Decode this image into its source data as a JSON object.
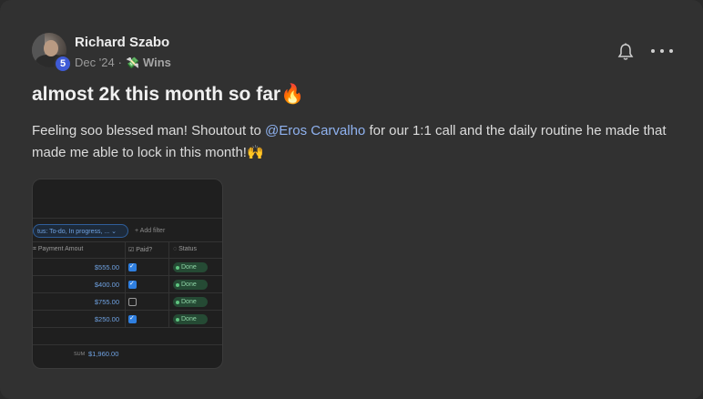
{
  "post": {
    "author": "Richard Szabo",
    "level": "5",
    "date": "Dec '24",
    "separator": "·",
    "category_icon": "money-wings-icon",
    "category": "Wins",
    "title": "almost 2k this month so far🔥",
    "body_before": "Feeling soo blessed man! Shoutout to ",
    "mention": "@Eros Carvalho",
    "body_after": " for our 1:1 call and the daily routine he made that made me able to lock in this month!🙌"
  },
  "attachment": {
    "filter_label": "tus: To-do, In progress, ... ⌄",
    "add_filter": "+ Add filter",
    "columns": {
      "amount": "Payment Amout",
      "paid": "Paid?",
      "status": "Status"
    },
    "rows": [
      {
        "amount": "$555.00",
        "paid": true,
        "status": "Done"
      },
      {
        "amount": "$400.00",
        "paid": true,
        "status": "Done"
      },
      {
        "amount": "$755.00",
        "paid": false,
        "status": "Done"
      },
      {
        "amount": "$250.00",
        "paid": true,
        "status": "Done"
      }
    ],
    "sum_label": "SUM",
    "sum_value": "$1,960.00"
  },
  "colors": {
    "card_bg": "#313131",
    "mention": "#8fb2f0",
    "level_badge": "#3f5bd6"
  }
}
